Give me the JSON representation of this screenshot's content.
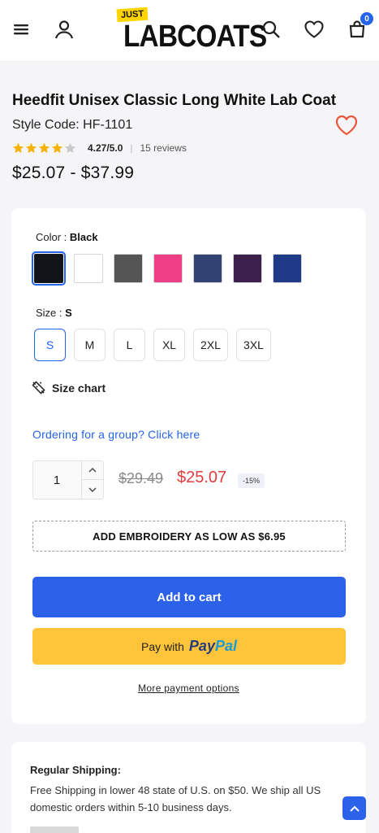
{
  "header": {
    "logo_tag": "JUST",
    "logo_text": "LABCOATS",
    "cart_count": "0",
    "icons": [
      "menu-icon",
      "account-icon",
      "search-icon",
      "wishlist-icon",
      "cart-icon"
    ]
  },
  "product": {
    "title": "Heedfit Unisex Classic Long White Lab Coat",
    "style_code": "Style Code: HF-1101",
    "rating": 4.27,
    "rating_text": "4.27/5.0",
    "separator": "|",
    "reviews": "15 reviews",
    "price_range": "$25.07 - $37.99"
  },
  "options": {
    "color_label": "Color : ",
    "color_value": "Black",
    "colors": [
      "#111418",
      "#ffffff",
      "#555555",
      "#ee3f86",
      "#324373",
      "#3b1f4d",
      "#1f3a87"
    ],
    "size_label": "Size : ",
    "size_value": "S",
    "sizes": [
      "S",
      "M",
      "L",
      "XL",
      "2XL",
      "3XL"
    ],
    "size_chart": "Size chart",
    "group_link": "Ordering for a group? Click here"
  },
  "purchase": {
    "quantity": "1",
    "old_price": "$29.49",
    "new_price": "$25.07",
    "discount": "-15%",
    "embroidery": "ADD EMBROIDERY AS LOW AS $6.95",
    "add_to_cart": "Add to cart",
    "pay_with": "Pay with",
    "paypal_1": "Pay",
    "paypal_2": "Pal",
    "more_payment": "More payment options"
  },
  "shipping": {
    "title": "Regular Shipping:",
    "text": "Free Shipping in lower 48 state of U.S. on $50. We ship all US domestic orders within 5-10 business days."
  },
  "colors": {
    "accent": "#2c62ea",
    "sale": "#e23b3b",
    "star": "#f5b301",
    "paypal_bg": "#ffc439"
  }
}
